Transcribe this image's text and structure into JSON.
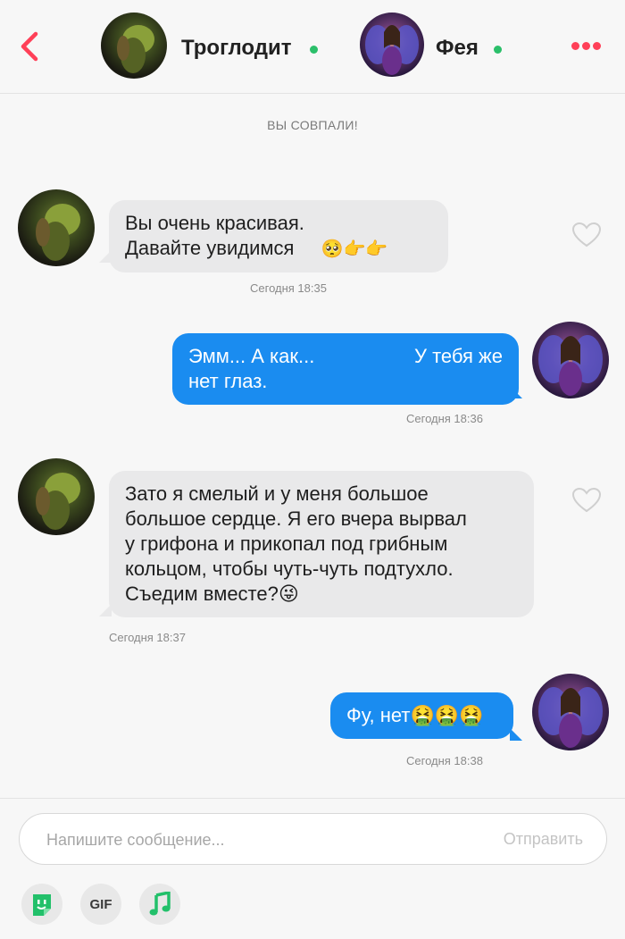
{
  "header": {
    "contact_name": "Троглодит",
    "user_name": "Фея",
    "accent_color": "#ff4058",
    "online_color": "#2bbf6a",
    "back_icon": "chevron-left-icon",
    "more_icon": "more-dots-icon"
  },
  "match_banner": "ВЫ СОВПАЛИ!",
  "messages": [
    {
      "direction": "in",
      "text_lines": [
        "Вы очень красивая.",
        "Давайте увидимся"
      ],
      "emoji": "🥺👉👉",
      "timestamp": "Сегодня 18:35"
    },
    {
      "direction": "out",
      "text_lines": [
        "Эмм... А как...",
        "нет глаз."
      ],
      "text_right": "У тебя же",
      "timestamp": "Сегодня 18:36"
    },
    {
      "direction": "in",
      "text_lines": [
        "Зато я смелый и у меня большое",
        "большое сердце. Я его вчера вырвал",
        "у грифона и прикопал под грибным",
        "кольцом, чтобы чуть-чуть подтухло.",
        "Съедим вместе?😜"
      ],
      "timestamp": "Сегодня 18:37"
    },
    {
      "direction": "out",
      "text_lines": [
        "Фу, нет🤮🤮🤮"
      ],
      "timestamp": "Сегодня 18:38"
    }
  ],
  "composer": {
    "placeholder": "Напишите сообщение...",
    "send_label": "Отправить"
  },
  "toolbar": {
    "gif_label": "GIF",
    "sticker_icon": "sticker-icon",
    "music_icon": "music-note-icon"
  },
  "colors": {
    "outgoing_bubble": "#1a8cf0",
    "incoming_bubble": "#e9e9ea",
    "sticker_green": "#22c06a"
  }
}
